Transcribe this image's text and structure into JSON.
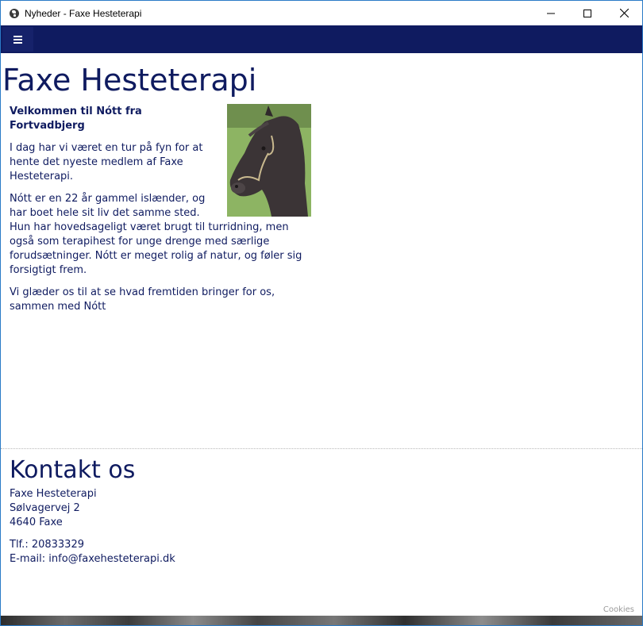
{
  "window": {
    "title": "Nyheder - Faxe Hesteterapi"
  },
  "site": {
    "title": "Faxe Hesteterapi"
  },
  "article": {
    "heading": "Velkommen til Nótt fra Fortvadbjerg",
    "paragraphs": [
      "I dag har vi været en tur på fyn for at hente det nyeste medlem af Faxe Hesteterapi.",
      "Nótt er en 22 år gammel islænder, og har boet hele sit liv det samme sted. Hun har hovedsageligt været brugt til turridning, men også som terapihest for unge drenge med særlige forudsætninger. Nótt er meget rolig af natur, og føler sig forsigtigt frem.",
      "Vi glæder os til at se hvad fremtiden bringer for os, sammen med Nótt"
    ]
  },
  "contact": {
    "title": "Kontakt os",
    "name": "Faxe Hesteterapi",
    "street": "Sølvagervej 2",
    "city": "4640 Faxe",
    "phone": "Tlf.: 20833329",
    "email": "E-mail: info@faxehesteterapi.dk"
  },
  "footer": {
    "cookies": "Cookies"
  },
  "colors": {
    "navy": "#0f1b60",
    "window_border": "#2b7bc7"
  }
}
